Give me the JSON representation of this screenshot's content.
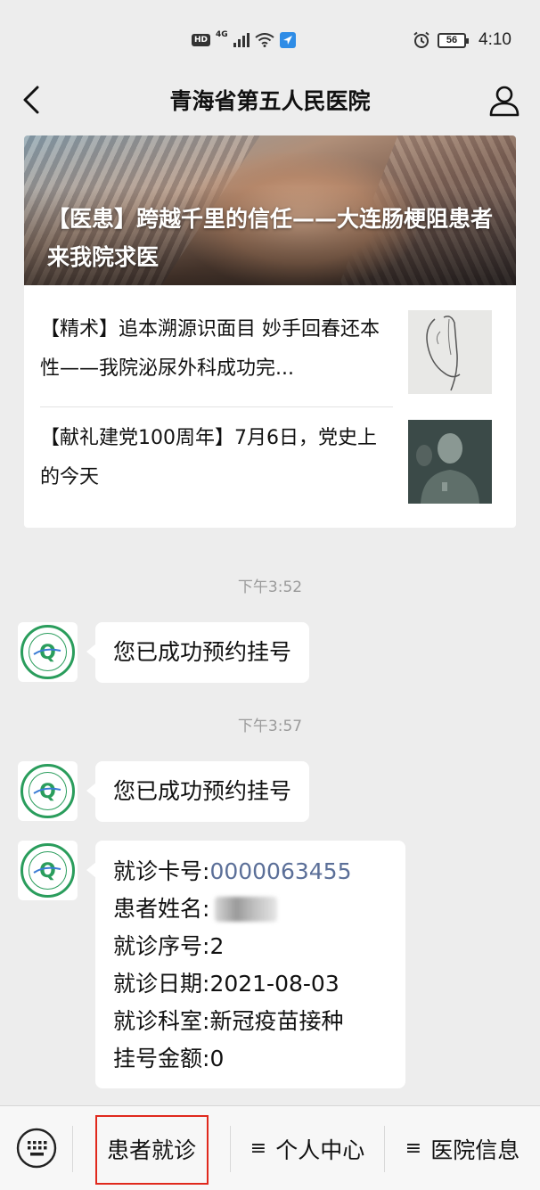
{
  "status_bar": {
    "hd": "HD",
    "network": "4G",
    "battery": "56",
    "time": "4:10"
  },
  "header": {
    "title": "青海省第五人民医院"
  },
  "news": {
    "hero_title": "【医患】跨越千里的信任——大连肠梗阻患者来我院求医",
    "items": [
      {
        "title": "【精术】追本溯源识面目 妙手回春还本性——我院泌尿外科成功完..."
      },
      {
        "title": "【献礼建党100周年】7月6日，党史上的今天"
      }
    ]
  },
  "chat": {
    "timestamps": [
      "下午3:52",
      "下午3:57"
    ],
    "messages": [
      {
        "text": "您已成功预约挂号"
      },
      {
        "text": "您已成功预约挂号"
      }
    ],
    "appointment": {
      "card_label": "就诊卡号: ",
      "card_value": "0000063455",
      "name_label": "患者姓名:",
      "seq_label": "就诊序号: ",
      "seq_value": "2",
      "date_label": "就诊日期: ",
      "date_value": "2021-08-03",
      "dept_label": "就诊科室: ",
      "dept_value": "新冠疫苗接种",
      "fee_label": "挂号金额: ",
      "fee_value": "0"
    }
  },
  "bottom_menu": {
    "items": [
      {
        "label": "患者就诊"
      },
      {
        "label": "个人中心"
      },
      {
        "label": "医院信息"
      }
    ],
    "menu_glyph": "≡"
  },
  "colors": {
    "background": "#ededed",
    "link": "#5b6f98",
    "highlight": "#e0291d",
    "logo_green": "#2a9d5c"
  }
}
